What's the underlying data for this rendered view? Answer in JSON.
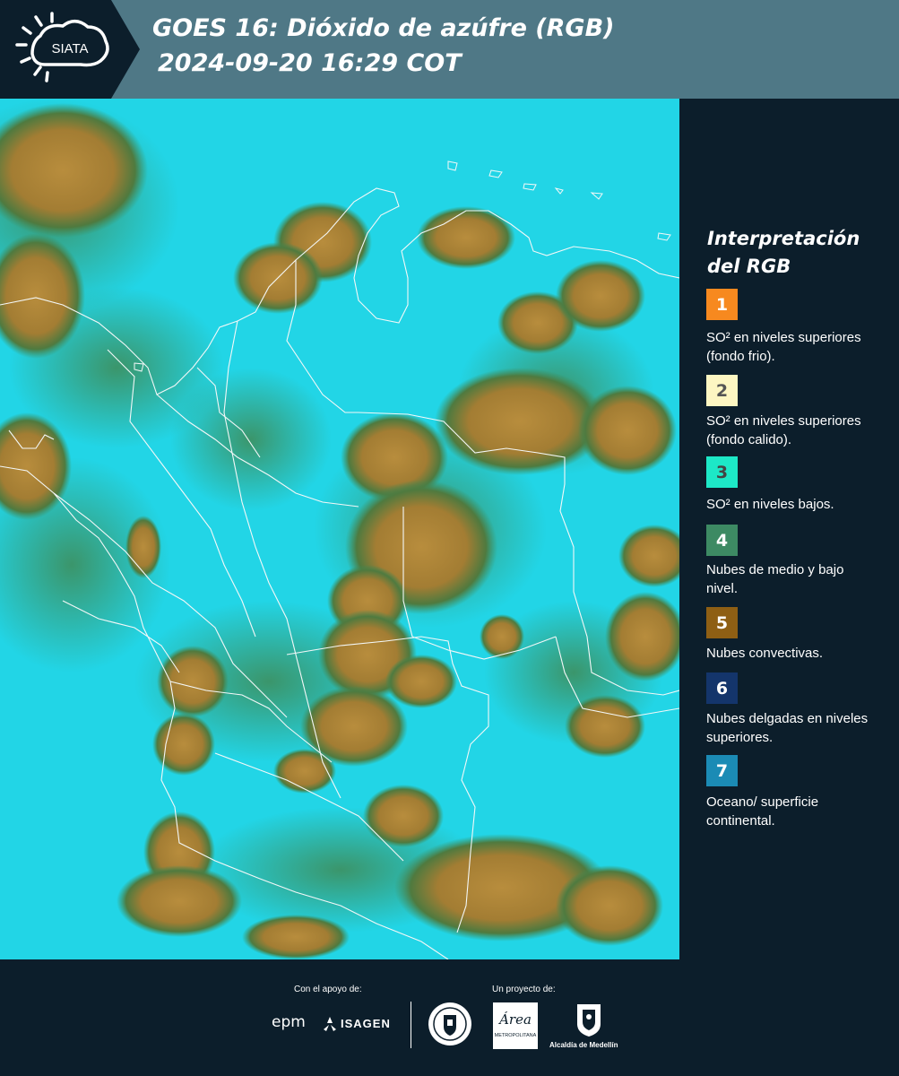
{
  "header": {
    "logo_text": "SIATA",
    "title_line1": "GOES 16: Dióxido de azúfre (RGB)",
    "title_line2": "2024-09-20 16:29 COT"
  },
  "legend": {
    "title_line1": "Interpretación",
    "title_line2": "del RGB",
    "items": [
      {
        "number": "1",
        "color": "#f7891f",
        "number_color": "#ffffff",
        "description": "SO² en niveles superiores (fondo frio)."
      },
      {
        "number": "2",
        "color": "#fdf6c2",
        "number_color": "#555555",
        "description": "SO² en niveles superiores (fondo calido)."
      },
      {
        "number": "3",
        "color": "#1de8c7",
        "number_color": "#444444",
        "description": "SO² en niveles bajos."
      },
      {
        "number": "4",
        "color": "#3d8a63",
        "number_color": "#ffffff",
        "description": "Nubes de medio y bajo nivel."
      },
      {
        "number": "5",
        "color": "#8e5f14",
        "number_color": "#ffffff",
        "description": "Nubes convectivas."
      },
      {
        "number": "6",
        "color": "#14356b",
        "number_color": "#ffffff",
        "description": "Nubes delgadas en niveles superiores."
      },
      {
        "number": "7",
        "color": "#1b8bb5",
        "number_color": "#ffffff",
        "description": "Oceano/ superficie continental."
      }
    ]
  },
  "footer": {
    "support_label": "Con el apoyo de:",
    "project_label": "Un proyecto de:",
    "epm_logo": "epm",
    "isagen_logo": "ISAGEN",
    "amva_logo": "Área",
    "amva_sub": "METROPOLITANA",
    "alcaldia_logo": "Alcaldía de Medellín"
  },
  "colors": {
    "header_bg": "#4f7886",
    "dark_bg": "#0c1e2b",
    "sky": "#20d6e8",
    "cloud": "#b78b3c",
    "cloud_edge": "#3f8a55"
  }
}
